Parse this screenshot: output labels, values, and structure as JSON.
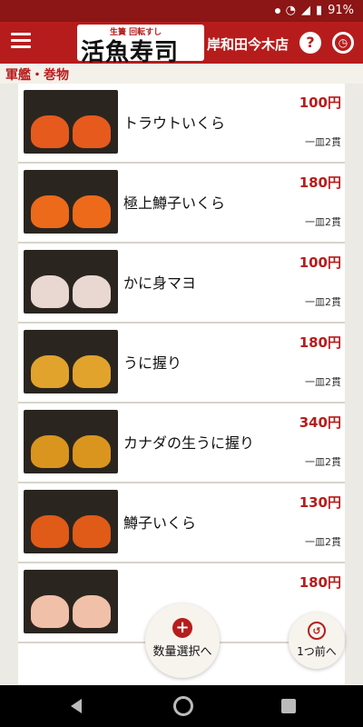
{
  "status": {
    "battery": "91%"
  },
  "header": {
    "logo_sub": "生簀 回転すし",
    "logo_main": "活魚寿司",
    "branch": "岸和田今木店",
    "help_glyph": "?",
    "clock_glyph": "◷"
  },
  "section_title": "軍艦・巻物",
  "items": [
    {
      "name": "トラウトいくら",
      "price": "100円",
      "portion": "一皿2貫",
      "colors": [
        "#e65a1e",
        "#e65a1e"
      ]
    },
    {
      "name": "極上鱒子いくら",
      "price": "180円",
      "portion": "一皿2貫",
      "colors": [
        "#ec6a1a",
        "#ec6a1a"
      ]
    },
    {
      "name": "かに身マヨ",
      "price": "100円",
      "portion": "一皿2貫",
      "colors": [
        "#e9d7d2",
        "#e9d7d2"
      ]
    },
    {
      "name": "うに握り",
      "price": "180円",
      "portion": "一皿2貫",
      "colors": [
        "#e1a32c",
        "#e1a32c"
      ]
    },
    {
      "name": "カナダの生うに握り",
      "price": "340円",
      "portion": "一皿2貫",
      "colors": [
        "#d9951e",
        "#d9951e"
      ]
    },
    {
      "name": "鱒子いくら",
      "price": "130円",
      "portion": "一皿2貫",
      "colors": [
        "#e05a18",
        "#e05a18"
      ]
    },
    {
      "name": "",
      "price": "180円",
      "portion": "",
      "colors": [
        "#f1c0a8",
        "#f1c0a8"
      ]
    }
  ],
  "buttons": {
    "qty_icon": "+",
    "qty_label": "数量選択へ",
    "back_icon": "↺",
    "back_label": "1つ前へ"
  }
}
